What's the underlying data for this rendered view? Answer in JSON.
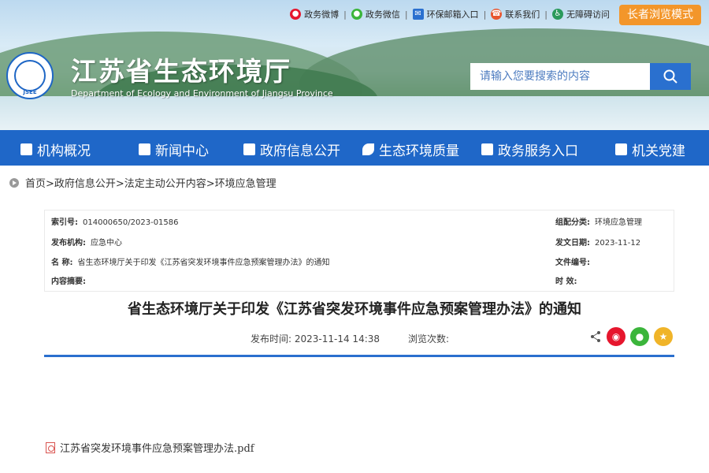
{
  "topbar": {
    "links": [
      {
        "label": "政务微博",
        "icon": "weibo-icon"
      },
      {
        "label": "政务微信",
        "icon": "wechat-icon"
      },
      {
        "label": "环保邮箱入口",
        "icon": "mail-icon"
      },
      {
        "label": "联系我们",
        "icon": "phone-icon"
      },
      {
        "label": "无障碍访问",
        "icon": "accessibility-icon"
      }
    ],
    "separator": "|",
    "elder_mode_label": "长者浏览模式"
  },
  "header": {
    "logo_text": "JSEE",
    "title": "江苏省生态环境厅",
    "subtitle": "Department of Ecology and Environment of Jiangsu Province"
  },
  "search": {
    "placeholder": "请输入您要搜索的内容"
  },
  "nav": {
    "items": [
      {
        "label": "机构概况"
      },
      {
        "label": "新闻中心"
      },
      {
        "label": "政府信息公开"
      },
      {
        "label": "生态环境质量"
      },
      {
        "label": "政务服务入口"
      },
      {
        "label": "机关党建"
      }
    ]
  },
  "breadcrumb": "首页>政府信息公开>法定主动公开内容>环境应急管理",
  "meta": {
    "index_key": "索引号:",
    "index_val": "014000650/2023-01586",
    "org_key": "发布机构:",
    "org_val": "应急中心",
    "name_key": "名 称:",
    "name_val": "省生态环境厅关于印发《江苏省突发环境事件应急预案管理办法》的通知",
    "abstract_key": "内容摘要:",
    "abstract_val": "",
    "category_key": "组配分类:",
    "category_val": "环境应急管理",
    "date_key": "发文日期:",
    "date_val": "2023-11-12",
    "docno_key": "文件编号:",
    "docno_val": "",
    "validity_key": "时 效:",
    "validity_val": ""
  },
  "article": {
    "title": "省生态环境厅关于印发《江苏省突发环境事件应急预案管理办法》的通知",
    "publish_label": "发布时间:",
    "publish_time": "2023-11-14 14:38",
    "views_label": "浏览次数:",
    "views_value": ""
  },
  "share": {
    "icons": [
      "share-icon",
      "weibo-share-icon",
      "wechat-share-icon",
      "favorite-icon"
    ]
  },
  "attachment": {
    "filename": "江苏省突发环境事件应急预案管理办法.pdf"
  },
  "colors": {
    "nav_blue": "#1f67c8",
    "elder_orange": "#f3962a",
    "rule_blue": "#2a6fce",
    "weibo_red": "#e6162d",
    "wechat_green": "#3bb53b",
    "star_gold": "#f0b429"
  }
}
